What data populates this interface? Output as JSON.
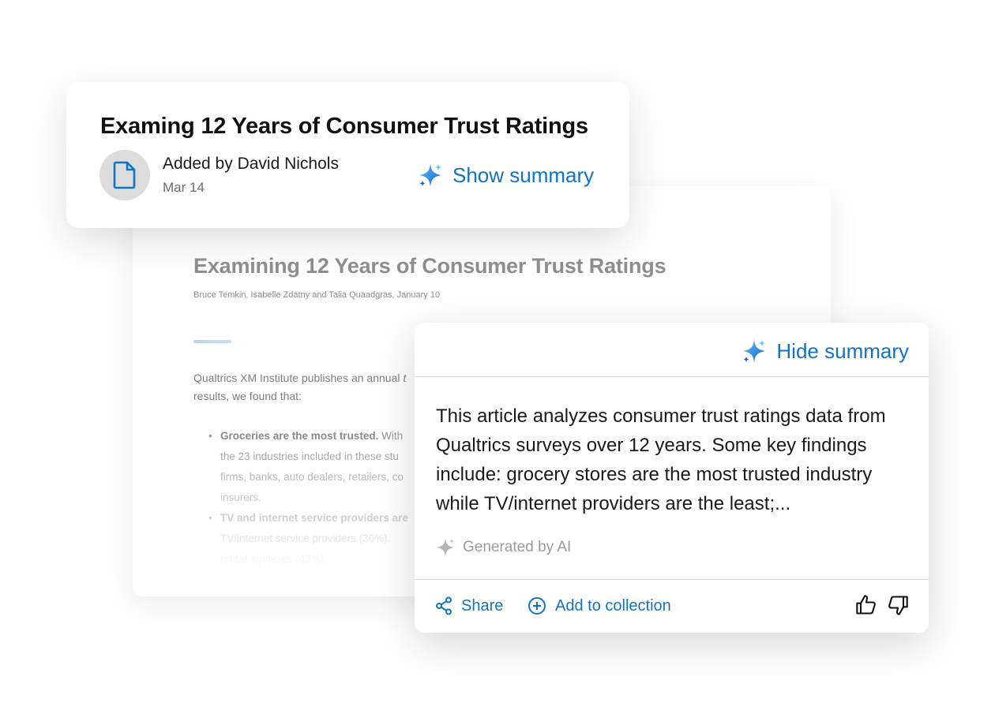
{
  "article": {
    "title": "Examining 12 Years of Consumer Trust Ratings",
    "byline": "Bruce Temkin, Isabelle Zdatny and Talia Quaadgras, January 10",
    "intro": "Qualtrics XM Institute publishes an annual t... results, we found that:",
    "intro_line1": "Qualtrics XM Institute publishes an annual",
    "intro_line1_tail": "t",
    "intro_line2": "results, we found that:",
    "bullets": [
      {
        "bold": "Groceries are the most trusted.",
        "lines": [
          "With",
          "the 23 industries included in these stu",
          "firms, banks, auto dealers, retailers, co",
          "insurers."
        ]
      },
      {
        "bold": "TV and internet service providers are",
        "lines": [
          "TV/internet service providers (36%).",
          "rental agencies (43%)."
        ]
      }
    ]
  },
  "header_card": {
    "title": "Examing 12 Years of Consumer Trust Ratings",
    "added_by": "Added by David Nichols",
    "date": "Mar 14",
    "show_summary": "Show summary",
    "avatar_icon": "document-icon"
  },
  "summary_card": {
    "hide_summary": "Hide summary",
    "text": "This article analyzes consumer trust ratings data from Qualtrics surveys over 12 years. Some key findings include: grocery stores are the most trusted industry while TV/internet providers are the least;...",
    "generated_label": "Generated by AI",
    "share_label": "Share",
    "add_collection_label": "Add to collection"
  },
  "colors": {
    "accent": "#1173c5",
    "sparkle_dark": "#1a5fd6",
    "sparkle_light": "#59c4f5"
  }
}
